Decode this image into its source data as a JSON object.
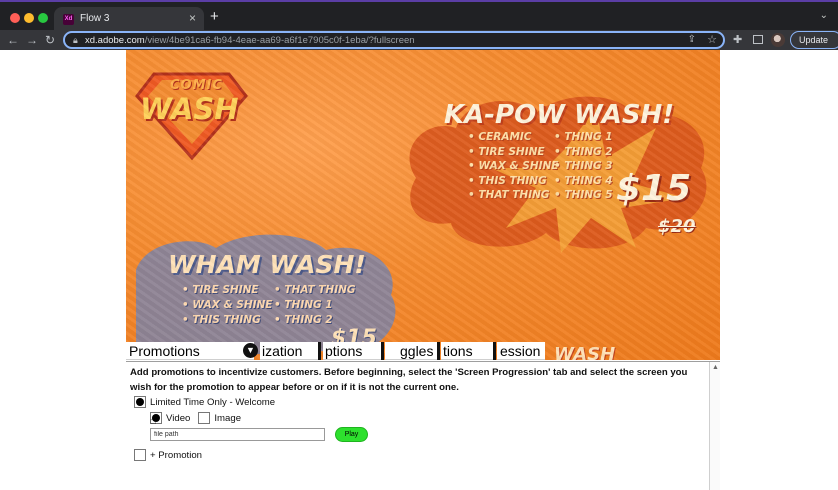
{
  "browser": {
    "tab_title": "Flow 3",
    "tab_favicon_text": "Xd",
    "new_tab": "+",
    "close_tab": "×",
    "url_host": "xd.adobe.com",
    "url_path": "/view/4be91ca6-fb94-4eae-aa69-a6f1e7905c0f-1eba/?fullscreen",
    "update_label": "Update"
  },
  "hero": {
    "logo_top": "COMIC",
    "logo_main": "WASH",
    "kapow": {
      "title": "KA-POW WASH!",
      "col1": [
        "• CERAMIC",
        "• TIRE SHINE",
        "• WAX & SHINE",
        "• THIS THING",
        "• THAT THING"
      ],
      "col2": [
        "• THING 1",
        "• THING 2",
        "• THING 3",
        "• THING 4",
        "• THING 5"
      ],
      "price": "$15",
      "old_price": "$20"
    },
    "wham": {
      "title": "WHAM WASH!",
      "col1": [
        "• TIRE SHINE",
        "• WAX & SHINE",
        "• THIS THING"
      ],
      "col2": [
        "• THAT THING",
        "• THING 1",
        "• THING 2"
      ],
      "price": "$15"
    },
    "third_title": "WASH"
  },
  "tabs": {
    "promotions": "Promotions",
    "t2": "ization",
    "t3": "ptions",
    "t4": "ggles",
    "t5": "tions",
    "t6": "ession"
  },
  "content": {
    "description": "Add promotions to incentivize customers. Before beginning, select the 'Screen Progression' tab and select the screen you wish for the promotion to appear before or on if it is not the current one.",
    "promo_label": "Limited Time Only - Welcome",
    "video_label": "Video",
    "image_label": "Image",
    "file_path_value": "file path",
    "play_label": "Play",
    "add_promotion_label": "+ Promotion"
  },
  "colors": {
    "hero_orange": "#f58a2e",
    "play_green": "#2de02d",
    "omnibox_border": "#8ab4f8"
  }
}
